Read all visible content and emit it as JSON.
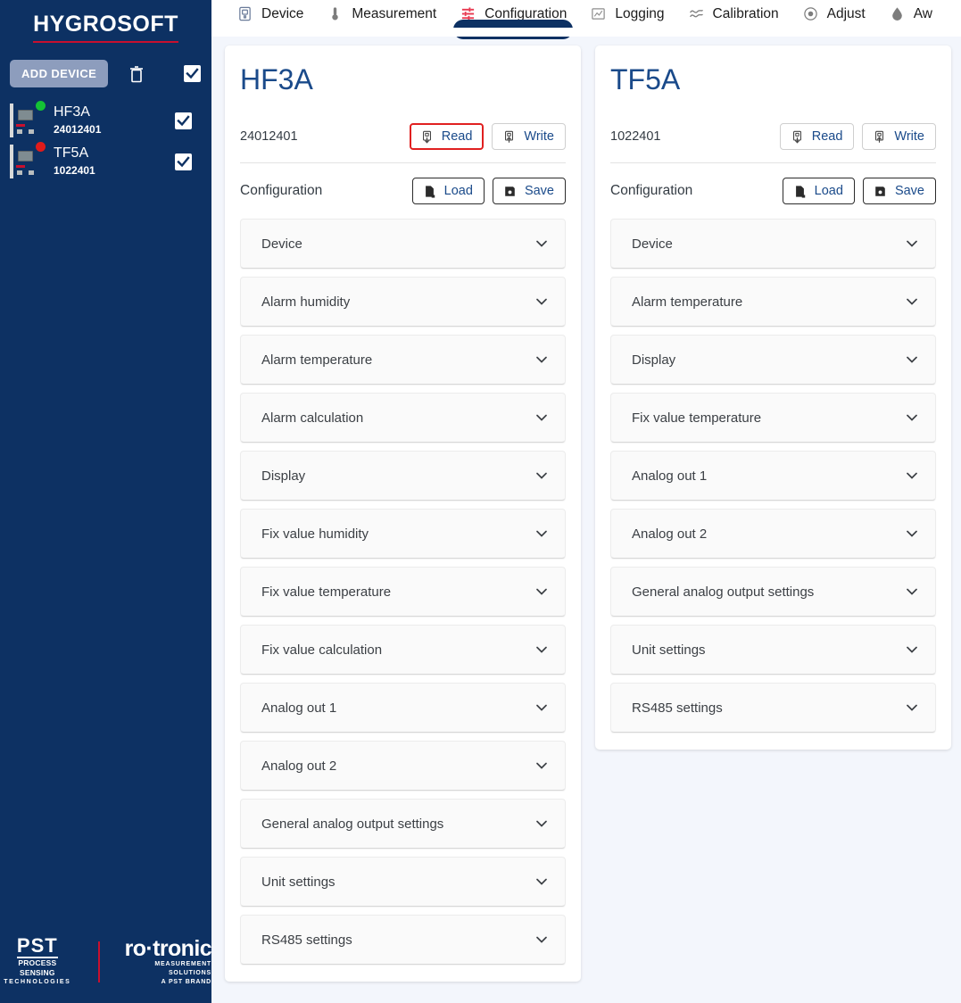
{
  "sidebar": {
    "brand": "HYGROSOFT",
    "add_device_label": "ADD DEVICE",
    "delete_icon": "trash-icon",
    "select_all_icon": "checkbox-checked-icon",
    "devices": [
      {
        "name": "HF3A",
        "serial": "24012401",
        "status_color": "#14c235",
        "checked": true
      },
      {
        "name": "TF5A",
        "serial": "1022401",
        "status_color": "#e01b1b",
        "checked": true
      }
    ],
    "footer": {
      "pst_main": "PST",
      "pst_sub1": "PROCESS SENSING",
      "pst_sub2": "TECHNOLOGIES",
      "rotronic_main": "ro·tronic",
      "rotronic_sub1": "MEASUREMENT SOLUTIONS",
      "rotronic_sub2": "A PST BRAND"
    }
  },
  "topnav": {
    "tabs": [
      {
        "label": "Device",
        "icon": "device-icon",
        "active": false
      },
      {
        "label": "Measurement",
        "icon": "thermometer-icon",
        "active": false
      },
      {
        "label": "Configuration",
        "icon": "sliders-icon",
        "active": true
      },
      {
        "label": "Logging",
        "icon": "chart-log-icon",
        "active": false
      },
      {
        "label": "Calibration",
        "icon": "wave-icon",
        "active": false
      },
      {
        "label": "Adjust",
        "icon": "target-dot-icon",
        "active": false
      },
      {
        "label": "Aw",
        "icon": "water-drop-icon",
        "active": false
      }
    ]
  },
  "colors": {
    "sidebar_bg": "#0d3163",
    "accent_red": "#c8102e",
    "title_blue": "#1a4a8a",
    "page_bg": "#f3f6fc",
    "add_device_bg": "#8d9dbd"
  },
  "panels": [
    {
      "title": "HF3A",
      "serial": "24012401",
      "read_label": "Read",
      "write_label": "Write",
      "read_highlighted": true,
      "config_label": "Configuration",
      "load_label": "Load",
      "save_label": "Save",
      "sections": [
        "Device",
        "Alarm humidity",
        "Alarm temperature",
        "Alarm calculation",
        "Display",
        "Fix value humidity",
        "Fix value temperature",
        "Fix value calculation",
        "Analog out 1",
        "Analog out 2",
        "General analog output settings",
        "Unit settings",
        "RS485 settings"
      ]
    },
    {
      "title": "TF5A",
      "serial": "1022401",
      "read_label": "Read",
      "write_label": "Write",
      "read_highlighted": false,
      "config_label": "Configuration",
      "load_label": "Load",
      "save_label": "Save",
      "sections": [
        "Device",
        "Alarm temperature",
        "Display",
        "Fix value temperature",
        "Analog out 1",
        "Analog out 2",
        "General analog output settings",
        "Unit settings",
        "RS485 settings"
      ]
    }
  ]
}
